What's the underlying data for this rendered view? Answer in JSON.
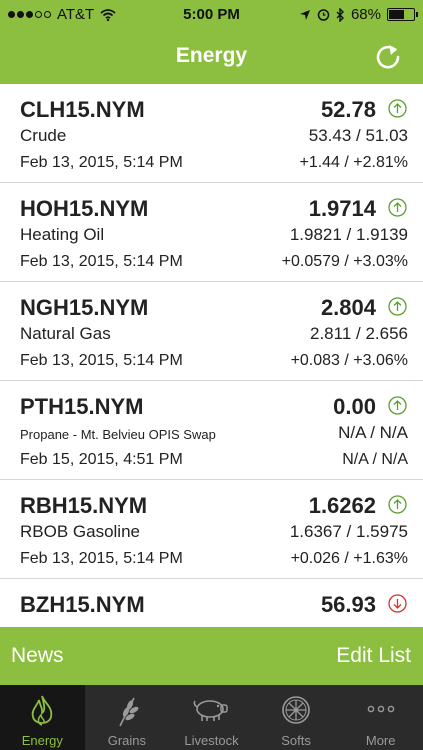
{
  "status": {
    "carrier": "AT&T",
    "time": "5:00 PM",
    "battery": "68%",
    "battery_level": 0.68
  },
  "nav": {
    "title": "Energy"
  },
  "quotes": [
    {
      "symbol": "CLH15.NYM",
      "name": "Crude",
      "price": "52.78",
      "range": "53.43 / 51.03",
      "date": "Feb 13, 2015, 5:14 PM",
      "change": "+1.44 / +2.81%",
      "trend": "up"
    },
    {
      "symbol": "HOH15.NYM",
      "name": "Heating Oil",
      "price": "1.9714",
      "range": "1.9821 / 1.9139",
      "date": "Feb 13, 2015, 5:14 PM",
      "change": "+0.0579 / +3.03%",
      "trend": "up"
    },
    {
      "symbol": "NGH15.NYM",
      "name": "Natural Gas",
      "price": "2.804",
      "range": "2.811 / 2.656",
      "date": "Feb 13, 2015, 5:14 PM",
      "change": "+0.083 / +3.06%",
      "trend": "up"
    },
    {
      "symbol": "PTH15.NYM",
      "name": "Propane - Mt. Belvieu OPIS Swap",
      "price": "0.00",
      "range": "N/A / N/A",
      "date": "Feb 15, 2015, 4:51 PM",
      "change": "N/A / N/A",
      "trend": "up"
    },
    {
      "symbol": "RBH15.NYM",
      "name": "RBOB Gasoline",
      "price": "1.6262",
      "range": "1.6367 / 1.5975",
      "date": "Feb 13, 2015, 5:14 PM",
      "change": "+0.026 / +1.63%",
      "trend": "up"
    },
    {
      "symbol": "BZH15.NYM",
      "name": "",
      "price": "56.93",
      "range": "",
      "date": "",
      "change": "",
      "trend": "down"
    }
  ],
  "actions": {
    "news": "News",
    "edit": "Edit List"
  },
  "tabs": [
    {
      "label": "Energy",
      "icon": "flame-icon",
      "active": true
    },
    {
      "label": "Grains",
      "icon": "wheat-icon",
      "active": false
    },
    {
      "label": "Livestock",
      "icon": "pig-icon",
      "active": false
    },
    {
      "label": "Softs",
      "icon": "orange-slice-icon",
      "active": false
    },
    {
      "label": "More",
      "icon": "more-dots-icon",
      "active": false
    }
  ],
  "colors": {
    "accent": "#8cbf3f",
    "up": "#5aa02c",
    "down": "#d0342c",
    "tabbar": "#2b2b2b"
  }
}
